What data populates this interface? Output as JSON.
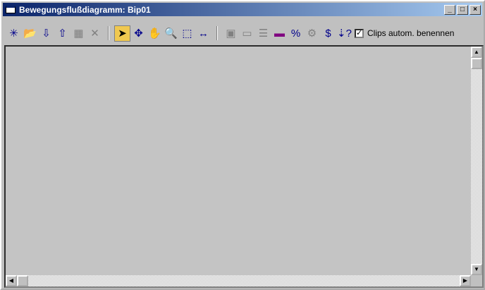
{
  "window": {
    "title": "Bewegungsflußdiagramm: Bip01",
    "minimize": "_",
    "maximize": "□",
    "close": "×"
  },
  "toolbar": {
    "groups": [
      [
        {
          "icon": "create-clip-icon",
          "glyph": "✳",
          "enabled": true
        },
        {
          "icon": "open-file-icon",
          "glyph": "📂",
          "enabled": true
        },
        {
          "icon": "insert-below-icon",
          "glyph": "⇩",
          "enabled": true
        },
        {
          "icon": "insert-above-icon",
          "glyph": "⇧",
          "enabled": true
        },
        {
          "icon": "grid-icon",
          "glyph": "▦",
          "enabled": false
        },
        {
          "icon": "delete-icon",
          "glyph": "✕",
          "enabled": false
        }
      ],
      [
        {
          "icon": "select-arrow-icon",
          "glyph": "➤",
          "enabled": true,
          "active": true
        },
        {
          "icon": "move-icon",
          "glyph": "✥",
          "enabled": true
        },
        {
          "icon": "pan-hand-icon",
          "glyph": "✋",
          "enabled": true
        },
        {
          "icon": "zoom-icon",
          "glyph": "🔍",
          "enabled": true
        },
        {
          "icon": "zoom-region-icon",
          "glyph": "⬚",
          "enabled": true
        },
        {
          "icon": "zoom-extents-icon",
          "glyph": "↔",
          "enabled": true
        }
      ],
      [
        {
          "icon": "shared-motion-icon",
          "glyph": "▣",
          "enabled": false
        },
        {
          "icon": "rectangle-icon",
          "glyph": "▭",
          "enabled": false
        },
        {
          "icon": "list-query-icon",
          "glyph": "☰",
          "enabled": false
        },
        {
          "icon": "select-color-icon",
          "glyph": "▬",
          "enabled": true,
          "color": "#800080"
        },
        {
          "icon": "percent-icon",
          "glyph": "%",
          "enabled": true
        },
        {
          "icon": "gears-icon",
          "glyph": "⚙",
          "enabled": false
        },
        {
          "icon": "dollar-icon",
          "glyph": "$",
          "enabled": true
        },
        {
          "icon": "transition-query-icon",
          "glyph": "⇣?",
          "enabled": true
        }
      ]
    ],
    "auto_name_clips": {
      "label": "Clips autom. benennen",
      "checked": true
    }
  }
}
